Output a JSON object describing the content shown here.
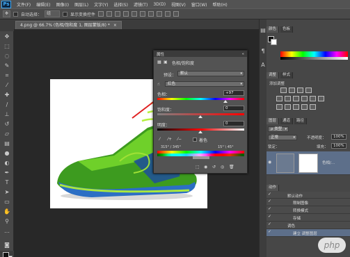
{
  "app": {
    "logo": "Ps"
  },
  "menu": [
    "文件(F)",
    "编辑(E)",
    "图像(I)",
    "图层(L)",
    "文字(Y)",
    "选择(S)",
    "滤镜(T)",
    "3D(D)",
    "视图(V)",
    "窗口(W)",
    "帮助(H)"
  ],
  "options": {
    "auto_select_label": "自动选择：",
    "auto_select_value": "组",
    "show_transform_label": "显示变换控件"
  },
  "document": {
    "tab_title": "4.png @ 66.7% (色相/饱和度 1, 图层蒙版/8) *",
    "close_symbol": "×"
  },
  "properties": {
    "panel_title": "属性",
    "collapse_symbol": "«",
    "adjustment_title": "色相/饱和度",
    "preset_label": "预设：",
    "preset_value": "默认",
    "channel_value": "红色",
    "hue_label": "色相：",
    "hue_value": "+97",
    "saturation_label": "饱和度：",
    "saturation_value": "0",
    "lightness_label": "明度：",
    "lightness_value": "0",
    "colorize_label": "着色",
    "range_left": "315° / 345°",
    "range_right": "15° \\ 45°"
  },
  "right": {
    "color_tab": "颜色",
    "swatches_tab": "色板",
    "adjustments_tab": "调整",
    "styles_tab": "样式",
    "add_adjustment_label": "添加调整",
    "layers_tab": "图层",
    "channels_tab": "通道",
    "paths_tab": "路径",
    "filter_kind": "ρ 类型",
    "blend_mode": "正常",
    "opacity_label": "不透明度：",
    "opacity_value": "100%",
    "lock_label": "锁定：",
    "fill_label": "填充：",
    "fill_value": "100%",
    "layer_name": "色相/...",
    "actions_tab": "动作",
    "actions": [
      {
        "label": "默认动作"
      },
      {
        "label": "限制图像"
      },
      {
        "label": "转换模式"
      },
      {
        "label": "存储"
      },
      {
        "label": "调色"
      },
      {
        "label": "建立 调整图层"
      }
    ]
  },
  "watermark": "php"
}
